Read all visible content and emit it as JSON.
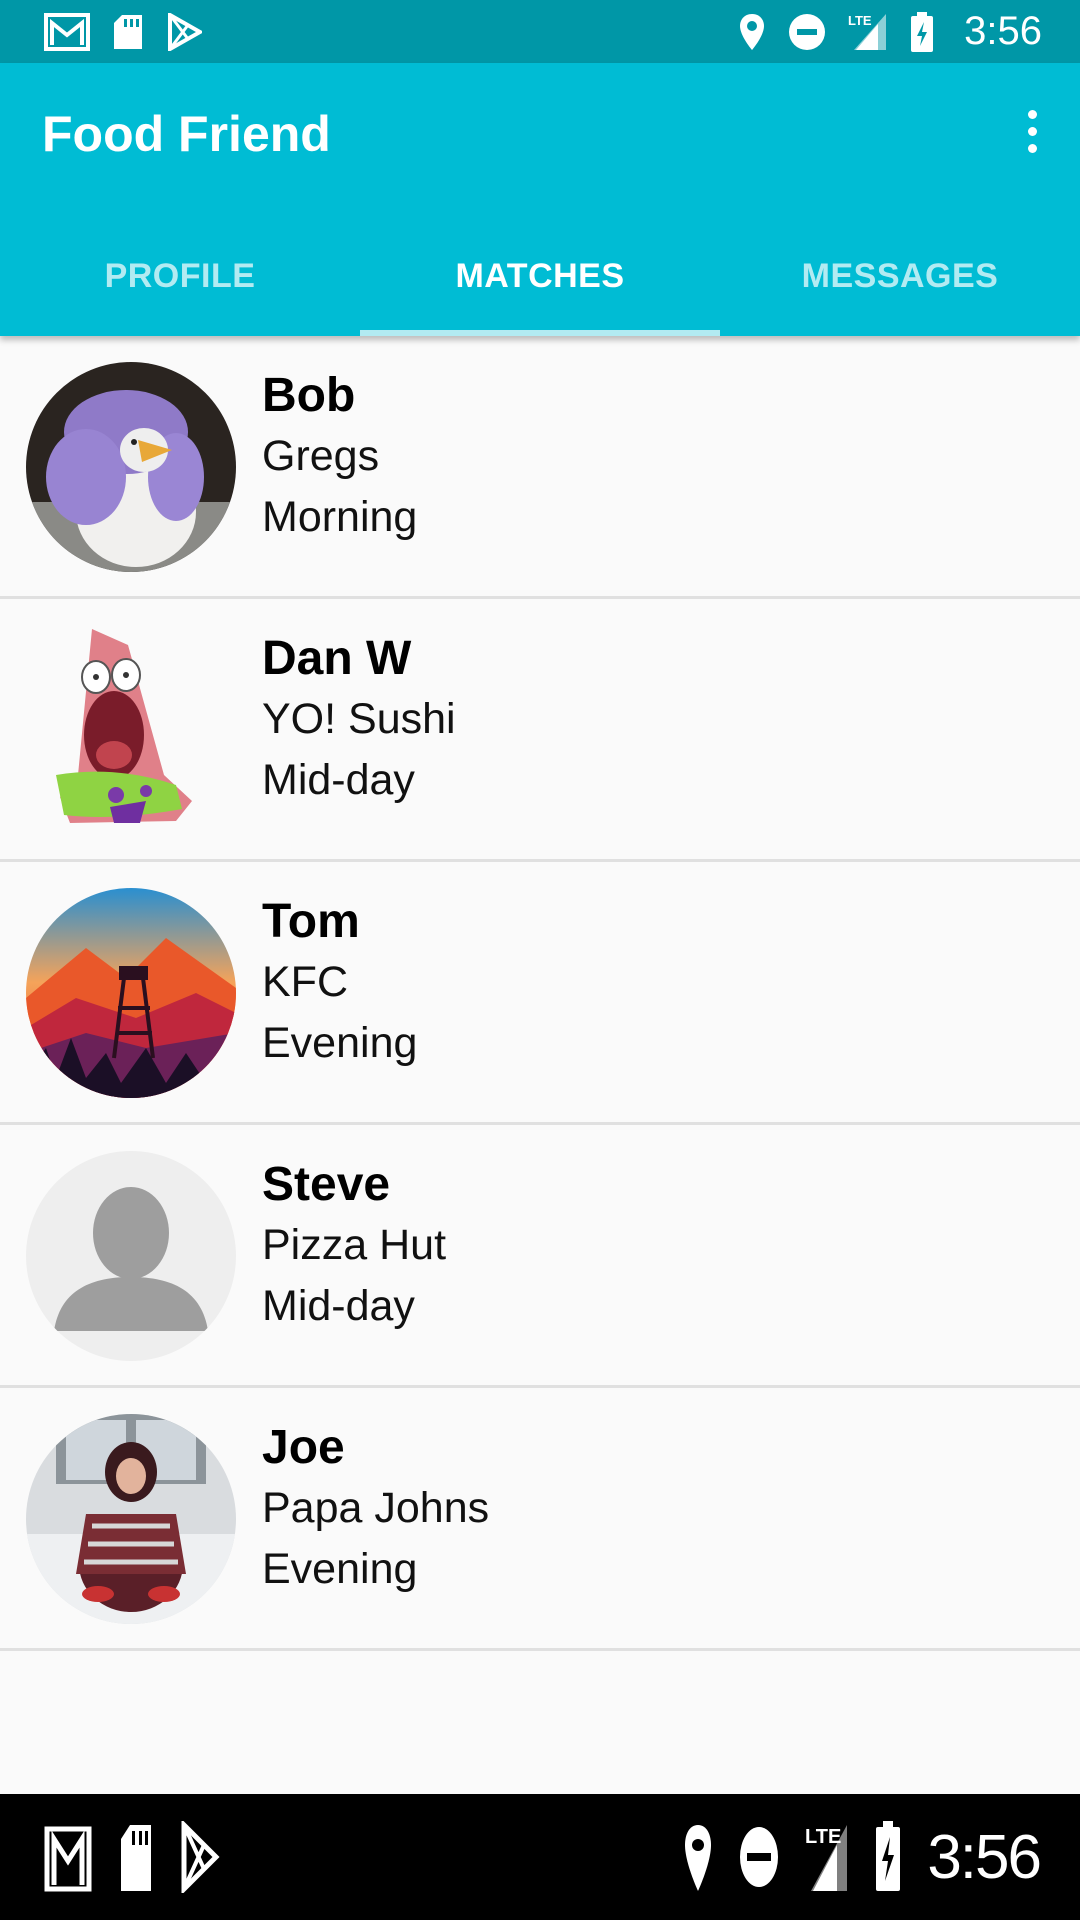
{
  "status_bar": {
    "time": "3:56",
    "left_icons": [
      "gmail-icon",
      "sd-card-icon",
      "play-store-icon"
    ],
    "right_icons": [
      "location-icon",
      "do-not-disturb-icon",
      "lte-signal-icon",
      "battery-charging-icon"
    ]
  },
  "app_bar": {
    "title": "Food Friend",
    "menu_icon": "more-vert-icon",
    "background": "#00bcd4",
    "status_color": "#0097a7"
  },
  "tabs": [
    {
      "label": "PROFILE",
      "active": false
    },
    {
      "label": "MATCHES",
      "active": true
    },
    {
      "label": "MESSAGES",
      "active": false
    }
  ],
  "matches": [
    {
      "name": "Bob",
      "restaurant": "Gregs",
      "time": "Morning",
      "avatar": "purple-penguin-plush"
    },
    {
      "name": "Dan W",
      "restaurant": "YO! Sushi",
      "time": "Mid-day",
      "avatar": "surprised-starfish-cartoon"
    },
    {
      "name": "Tom",
      "restaurant": "KFC",
      "time": "Evening",
      "avatar": "fire-lookout-tower-landscape"
    },
    {
      "name": "Steve",
      "restaurant": "Pizza Hut",
      "time": "Mid-day",
      "avatar": "default-person-placeholder"
    },
    {
      "name": "Joe",
      "restaurant": "Papa Johns",
      "time": "Evening",
      "avatar": "person-in-snow-photo"
    }
  ],
  "nav_bar": {
    "time": "3:56"
  }
}
